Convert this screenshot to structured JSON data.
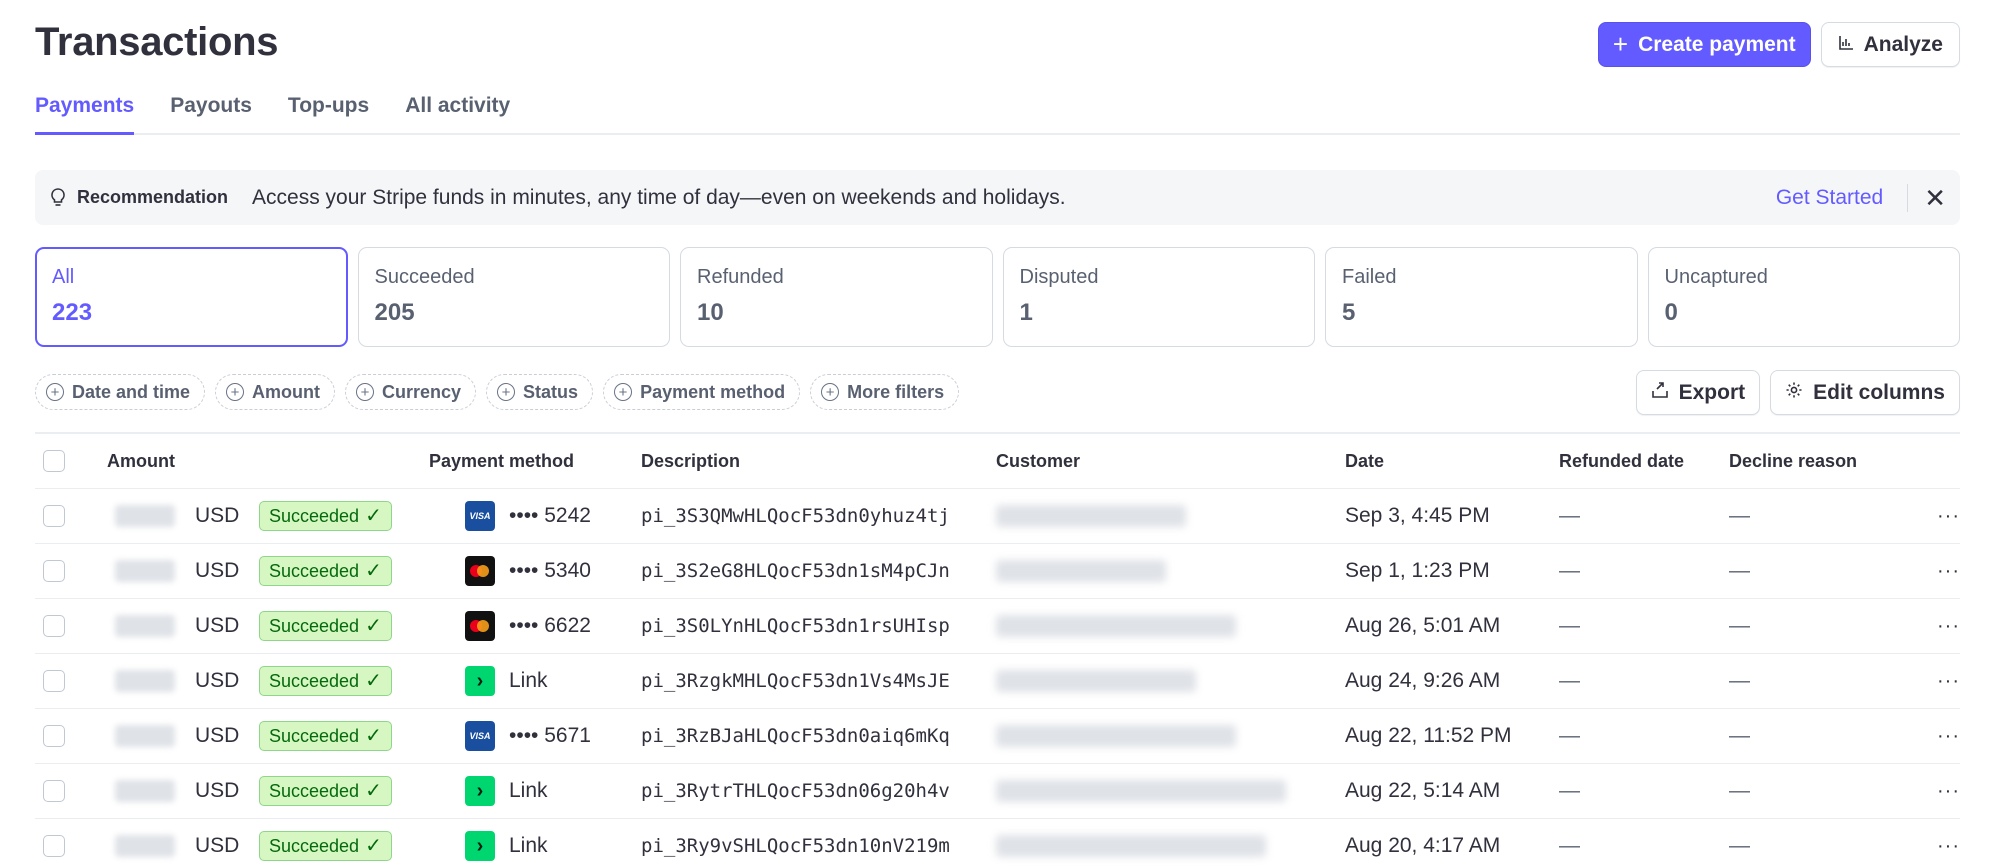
{
  "header": {
    "title": "Transactions",
    "create_payment_label": "Create payment",
    "analyze_label": "Analyze"
  },
  "tabs": [
    {
      "label": "Payments",
      "active": true
    },
    {
      "label": "Payouts",
      "active": false
    },
    {
      "label": "Top-ups",
      "active": false
    },
    {
      "label": "All activity",
      "active": false
    }
  ],
  "recommendation": {
    "icon": "lightbulb-icon",
    "label": "Recommendation",
    "text": "Access your Stripe funds in minutes, any time of day—even on weekends and holidays.",
    "link": "Get Started"
  },
  "status_cards": [
    {
      "label": "All",
      "count": "223",
      "active": true
    },
    {
      "label": "Succeeded",
      "count": "205",
      "active": false
    },
    {
      "label": "Refunded",
      "count": "10",
      "active": false
    },
    {
      "label": "Disputed",
      "count": "1",
      "active": false
    },
    {
      "label": "Failed",
      "count": "5",
      "active": false
    },
    {
      "label": "Uncaptured",
      "count": "0",
      "active": false
    }
  ],
  "filters": [
    "Date and time",
    "Amount",
    "Currency",
    "Status",
    "Payment method",
    "More filters"
  ],
  "toolbar": {
    "export_label": "Export",
    "edit_columns_label": "Edit columns"
  },
  "table": {
    "columns": {
      "amount": "Amount",
      "payment_method": "Payment method",
      "description": "Description",
      "customer": "Customer",
      "date": "Date",
      "refunded_date": "Refunded date",
      "decline_reason": "Decline reason"
    },
    "rows": [
      {
        "currency": "USD",
        "status": "Succeeded",
        "method_type": "visa",
        "method_text": "•••• 5242",
        "description": "pi_3S3QMwHLQocF53dn0yhuz4tj",
        "date": "Sep 3, 4:45 PM",
        "refunded_date": "—",
        "decline_reason": "—"
      },
      {
        "currency": "USD",
        "status": "Succeeded",
        "method_type": "mastercard",
        "method_text": "•••• 5340",
        "description": "pi_3S2eG8HLQocF53dn1sM4pCJn",
        "date": "Sep 1, 1:23 PM",
        "refunded_date": "—",
        "decline_reason": "—"
      },
      {
        "currency": "USD",
        "status": "Succeeded",
        "method_type": "mastercard",
        "method_text": "•••• 6622",
        "description": "pi_3S0LYnHLQocF53dn1rsUHIsp",
        "date": "Aug 26, 5:01 AM",
        "refunded_date": "—",
        "decline_reason": "—"
      },
      {
        "currency": "USD",
        "status": "Succeeded",
        "method_type": "link",
        "method_text": "Link",
        "description": "pi_3RzgkMHLQocF53dn1Vs4MsJE",
        "date": "Aug 24, 9:26 AM",
        "refunded_date": "—",
        "decline_reason": "—"
      },
      {
        "currency": "USD",
        "status": "Succeeded",
        "method_type": "visa",
        "method_text": "•••• 5671",
        "description": "pi_3RzBJaHLQocF53dn0aiq6mKq",
        "date": "Aug 22, 11:52 PM",
        "refunded_date": "—",
        "decline_reason": "—"
      },
      {
        "currency": "USD",
        "status": "Succeeded",
        "method_type": "link",
        "method_text": "Link",
        "description": "pi_3RytrTHLQocF53dn06g20h4v",
        "date": "Aug 22, 5:14 AM",
        "refunded_date": "—",
        "decline_reason": "—"
      },
      {
        "currency": "USD",
        "status": "Succeeded",
        "method_type": "link",
        "method_text": "Link",
        "description": "pi_3Ry9vSHLQocF53dn10nV219m",
        "date": "Aug 20, 4:17 AM",
        "refunded_date": "—",
        "decline_reason": "—"
      }
    ]
  },
  "colors": {
    "accent": "#635bff",
    "success_bg": "#d7f7c2",
    "success_text": "#05690d",
    "link_green": "#00d66f",
    "visa_blue": "#1a4fa0"
  }
}
